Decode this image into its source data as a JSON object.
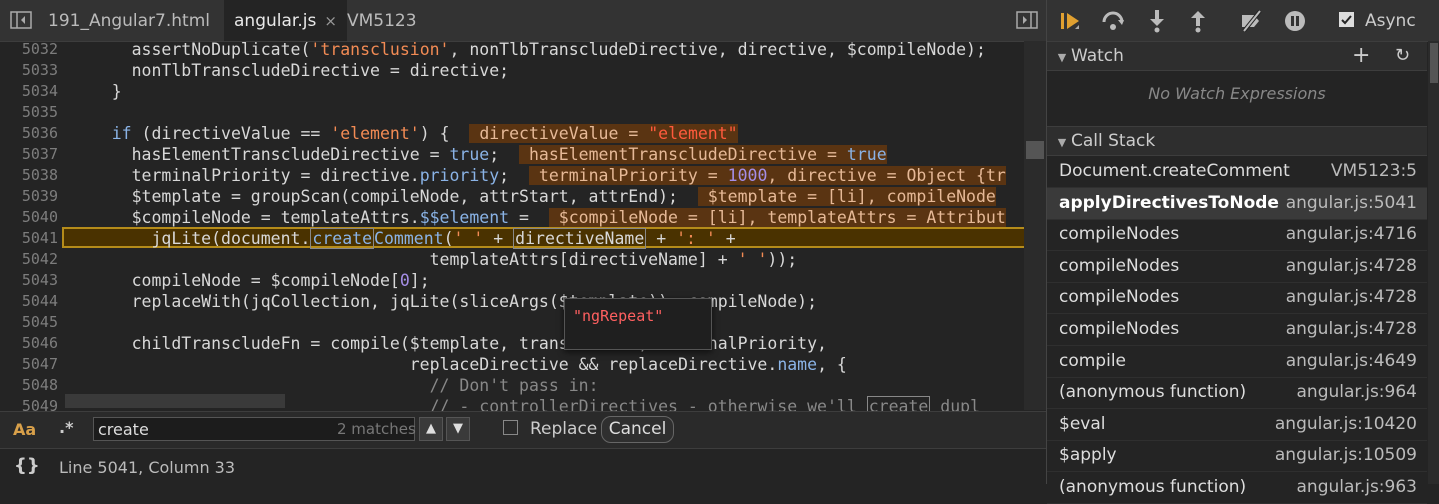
{
  "tabs": {
    "items": [
      {
        "label": "191_Angular7.html"
      },
      {
        "label": "angular.js",
        "close": "×"
      },
      {
        "label": "VM5123"
      }
    ]
  },
  "code": {
    "lines": [
      {
        "n": "5032"
      },
      {
        "n": "5033"
      },
      {
        "n": "5034"
      },
      {
        "n": "5035"
      },
      {
        "n": "5036"
      },
      {
        "n": "5037"
      },
      {
        "n": "5038"
      },
      {
        "n": "5039"
      },
      {
        "n": "5040"
      },
      {
        "n": "5041"
      },
      {
        "n": "5042"
      },
      {
        "n": "5043"
      },
      {
        "n": "5044"
      },
      {
        "n": "5045"
      },
      {
        "n": "5046"
      },
      {
        "n": "5047"
      },
      {
        "n": "5048"
      },
      {
        "n": "5049"
      }
    ],
    "tooltip": "\"ngRepeat\""
  },
  "search": {
    "case_label": "Aa",
    "regex_label": ".*",
    "value": "create",
    "matches": "2 matches",
    "up": "▲",
    "down": "▼",
    "replace_label": "Replace",
    "cancel_label": "Cancel"
  },
  "status": {
    "braces": "{}",
    "position": "Line 5041, Column 33"
  },
  "debugger": {
    "async_label": "Async",
    "async_checked": true,
    "watch_title": "Watch",
    "watch_add": "+",
    "watch_refresh": "↻",
    "watch_empty": "No Watch Expressions",
    "callstack_title": "Call Stack",
    "frames": [
      {
        "fn": "Document.createComment",
        "loc": "VM5123:5"
      },
      {
        "fn": "applyDirectivesToNode",
        "loc": "angular.js:5041",
        "selected": true
      },
      {
        "fn": "compileNodes",
        "loc": "angular.js:4716"
      },
      {
        "fn": "compileNodes",
        "loc": "angular.js:4728"
      },
      {
        "fn": "compileNodes",
        "loc": "angular.js:4728"
      },
      {
        "fn": "compileNodes",
        "loc": "angular.js:4728"
      },
      {
        "fn": "compile",
        "loc": "angular.js:4649"
      },
      {
        "fn": "(anonymous function)",
        "loc": "angular.js:964"
      },
      {
        "fn": "$eval",
        "loc": "angular.js:10420"
      },
      {
        "fn": "$apply",
        "loc": "angular.js:10509"
      },
      {
        "fn": "(anonymous function)",
        "loc": "angular.js:963"
      }
    ]
  }
}
